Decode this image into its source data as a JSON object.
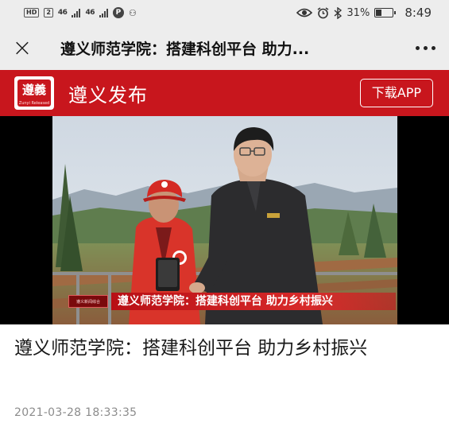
{
  "status_bar": {
    "hd_label": "HD",
    "sim_label": "2",
    "signal_1": "46",
    "signal_2": "46",
    "p_label": "P",
    "battery_percent": "31%",
    "battery_level": 0.31,
    "time": "8:49"
  },
  "title_bar": {
    "close_glyph": "×",
    "title": "遵义师范学院：搭建科创平台 助力..."
  },
  "brand_bar": {
    "logo_text": "遵義",
    "logo_subtext": "Zunyi Released",
    "name": "遵义发布",
    "download_label": "下载APP"
  },
  "video": {
    "channel_tag": "遵义新闻综合",
    "caption": "遵义师范学院：搭建科创平台 助力乡村振兴"
  },
  "article": {
    "title": "遵义师范学院：搭建科创平台 助力乡村振兴",
    "date": "2021-03-28 18:33:35"
  },
  "colors": {
    "brand_red": "#c8161d",
    "bar_gray": "#ededed"
  }
}
